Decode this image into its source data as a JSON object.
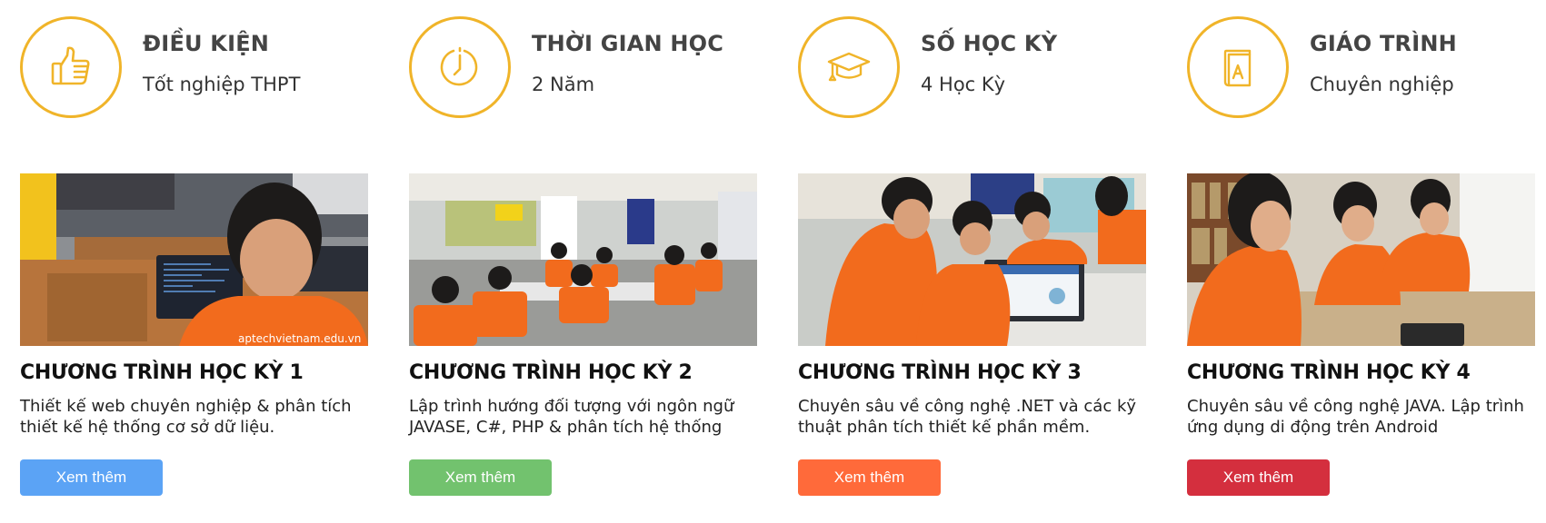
{
  "features": [
    {
      "title": "ĐIỀU KIỆN",
      "value": "Tốt nghiệp THPT",
      "icon": "thumbs-up-icon"
    },
    {
      "title": "THỜI GIAN HỌC",
      "value": "2 Năm",
      "icon": "clock-icon"
    },
    {
      "title": "SỐ HỌC KỲ",
      "value": "4 Học Kỳ",
      "icon": "graduation-cap-icon"
    },
    {
      "title": "GIÁO TRÌNH",
      "value": "Chuyên nghiệp",
      "icon": "book-icon"
    }
  ],
  "cards": [
    {
      "title": "CHƯƠNG TRÌNH HỌC KỲ 1",
      "description": "Thiết kế web chuyên nghiệp & phân tích thiết kế hệ thống cơ sở dữ liệu.",
      "button": "Xem thêm",
      "button_color": "#5ba3f5",
      "photo_caption": "aptechvietnam.edu.vn"
    },
    {
      "title": "CHƯƠNG TRÌNH HỌC KỲ 2",
      "description": "Lập trình hướng đối tượng với ngôn ngữ JAVASE, C#, PHP & phân tích hệ thống",
      "button": "Xem thêm",
      "button_color": "#72c26e"
    },
    {
      "title": "CHƯƠNG TRÌNH HỌC KỲ 3",
      "description": "Chuyên sâu về công nghệ .NET và các kỹ thuật phân tích thiết kế phần mềm.",
      "button": "Xem thêm",
      "button_color": "#ff6a3a"
    },
    {
      "title": "CHƯƠNG TRÌNH HỌC KỲ 4",
      "description": "Chuyên sâu về công nghệ JAVA. Lập trình ứng dụng di động trên Android",
      "button": "Xem thêm",
      "button_color": "#d42f3e"
    }
  ],
  "colors": {
    "accent": "#f0b429",
    "shirt_orange": "#f26b1d"
  }
}
